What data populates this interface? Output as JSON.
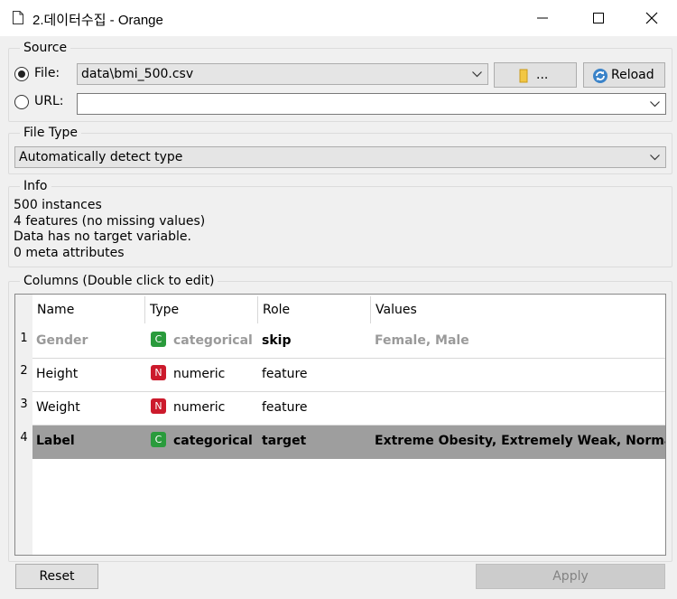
{
  "window": {
    "title": "2.데이터수집 - Orange"
  },
  "source": {
    "group_title": "Source",
    "file_label": "File:",
    "file_value": "data\\bmi_500.csv",
    "browse_label": "...",
    "reload_label": "Reload",
    "url_label": "URL:",
    "url_value": ""
  },
  "file_type": {
    "group_title": "File Type",
    "value": "Automatically detect type"
  },
  "info": {
    "group_title": "Info",
    "lines": [
      "500 instances",
      "4 features (no missing values)",
      "Data has no target variable.",
      "0 meta attributes"
    ]
  },
  "columns": {
    "group_title": "Columns (Double click to edit)",
    "headers": [
      "Name",
      "Type",
      "Role",
      "Values"
    ],
    "rows": [
      {
        "num": "1",
        "name": "Gender",
        "type_badge": "C",
        "type": "categorical",
        "role": "skip",
        "values": "Female, Male"
      },
      {
        "num": "2",
        "name": "Height",
        "type_badge": "N",
        "type": "numeric",
        "role": "feature",
        "values": ""
      },
      {
        "num": "3",
        "name": "Weight",
        "type_badge": "N",
        "type": "numeric",
        "role": "feature",
        "values": ""
      },
      {
        "num": "4",
        "name": "Label",
        "type_badge": "C",
        "type": "categorical",
        "role": "target",
        "values": "Extreme Obesity, Extremely Weak, Normal..."
      }
    ]
  },
  "buttons": {
    "reset": "Reset",
    "apply": "Apply"
  },
  "colors": {
    "categorical_badge": "#2a9b3c",
    "numeric_badge": "#cc1a2c",
    "selected_row": "#9e9e9e"
  }
}
